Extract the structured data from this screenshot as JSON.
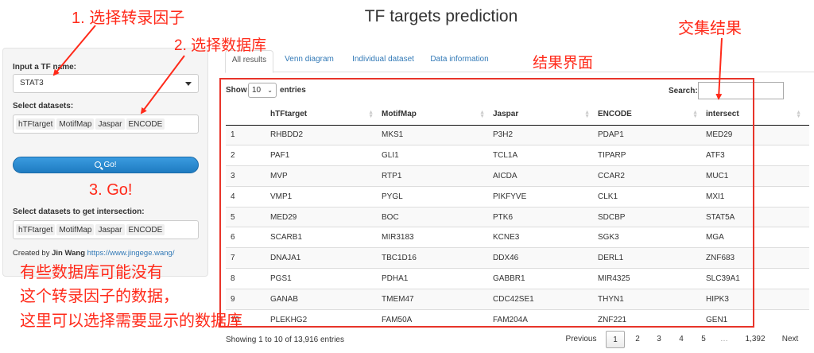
{
  "app_title": "TF targets prediction",
  "sidebar": {
    "tf_label": "Input a TF name:",
    "tf_value": "STAT3",
    "datasets_label": "Select datasets:",
    "datasets": [
      "hTFtarget",
      "MotifMap",
      "Jaspar",
      "ENCODE"
    ],
    "go_label": "Go!",
    "intersection_label": "Select datasets to get intersection:",
    "intersection_datasets": [
      "hTFtarget",
      "MotifMap",
      "Jaspar",
      "ENCODE"
    ],
    "credit_prefix": "Created by ",
    "credit_author": "Jin Wang",
    "credit_url": "https://www.jingege.wang/"
  },
  "tabs": [
    "All results",
    "Venn diagram",
    "Individual dataset",
    "Data information"
  ],
  "table_controls": {
    "show_label": "Show",
    "page_length": "10",
    "entries_label": "entries",
    "search_label": "Search:"
  },
  "table": {
    "columns": [
      "",
      "hTFtarget",
      "MotifMap",
      "Jaspar",
      "ENCODE",
      "intersect"
    ],
    "rows": [
      [
        "1",
        "RHBDD2",
        "MKS1",
        "P3H2",
        "PDAP1",
        "MED29"
      ],
      [
        "2",
        "PAF1",
        "GLI1",
        "TCL1A",
        "TIPARP",
        "ATF3"
      ],
      [
        "3",
        "MVP",
        "RTP1",
        "AICDA",
        "CCAR2",
        "MUC1"
      ],
      [
        "4",
        "VMP1",
        "PYGL",
        "PIKFYVE",
        "CLK1",
        "MXI1"
      ],
      [
        "5",
        "MED29",
        "BOC",
        "PTK6",
        "SDCBP",
        "STAT5A"
      ],
      [
        "6",
        "SCARB1",
        "MIR3183",
        "KCNE3",
        "SGK3",
        "MGA"
      ],
      [
        "7",
        "DNAJA1",
        "TBC1D16",
        "DDX46",
        "DERL1",
        "ZNF683"
      ],
      [
        "8",
        "PGS1",
        "PDHA1",
        "GABBR1",
        "MIR4325",
        "SLC39A1"
      ],
      [
        "9",
        "GANAB",
        "TMEM47",
        "CDC42SE1",
        "THYN1",
        "HIPK3"
      ],
      [
        "10",
        "PLEKHG2",
        "FAM50A",
        "FAM204A",
        "ZNF221",
        "GEN1"
      ]
    ]
  },
  "footer": {
    "info": "Showing 1 to 10 of 13,916 entries",
    "pagination": [
      "Previous",
      "1",
      "2",
      "3",
      "4",
      "5",
      "…",
      "1,392",
      "Next"
    ],
    "current_page": "1"
  },
  "annotations": {
    "step1": "1. 选择转录因子",
    "step2": "2. 选择数据库",
    "step3": "3. Go!",
    "intersect_note": "交集结果",
    "results_note": "结果界面",
    "note_lines": [
      "有些数据库可能没有",
      "这个转录因子的数据，",
      "这里可以选择需要显示的数据库"
    ],
    "color": "#ff2a1a"
  }
}
